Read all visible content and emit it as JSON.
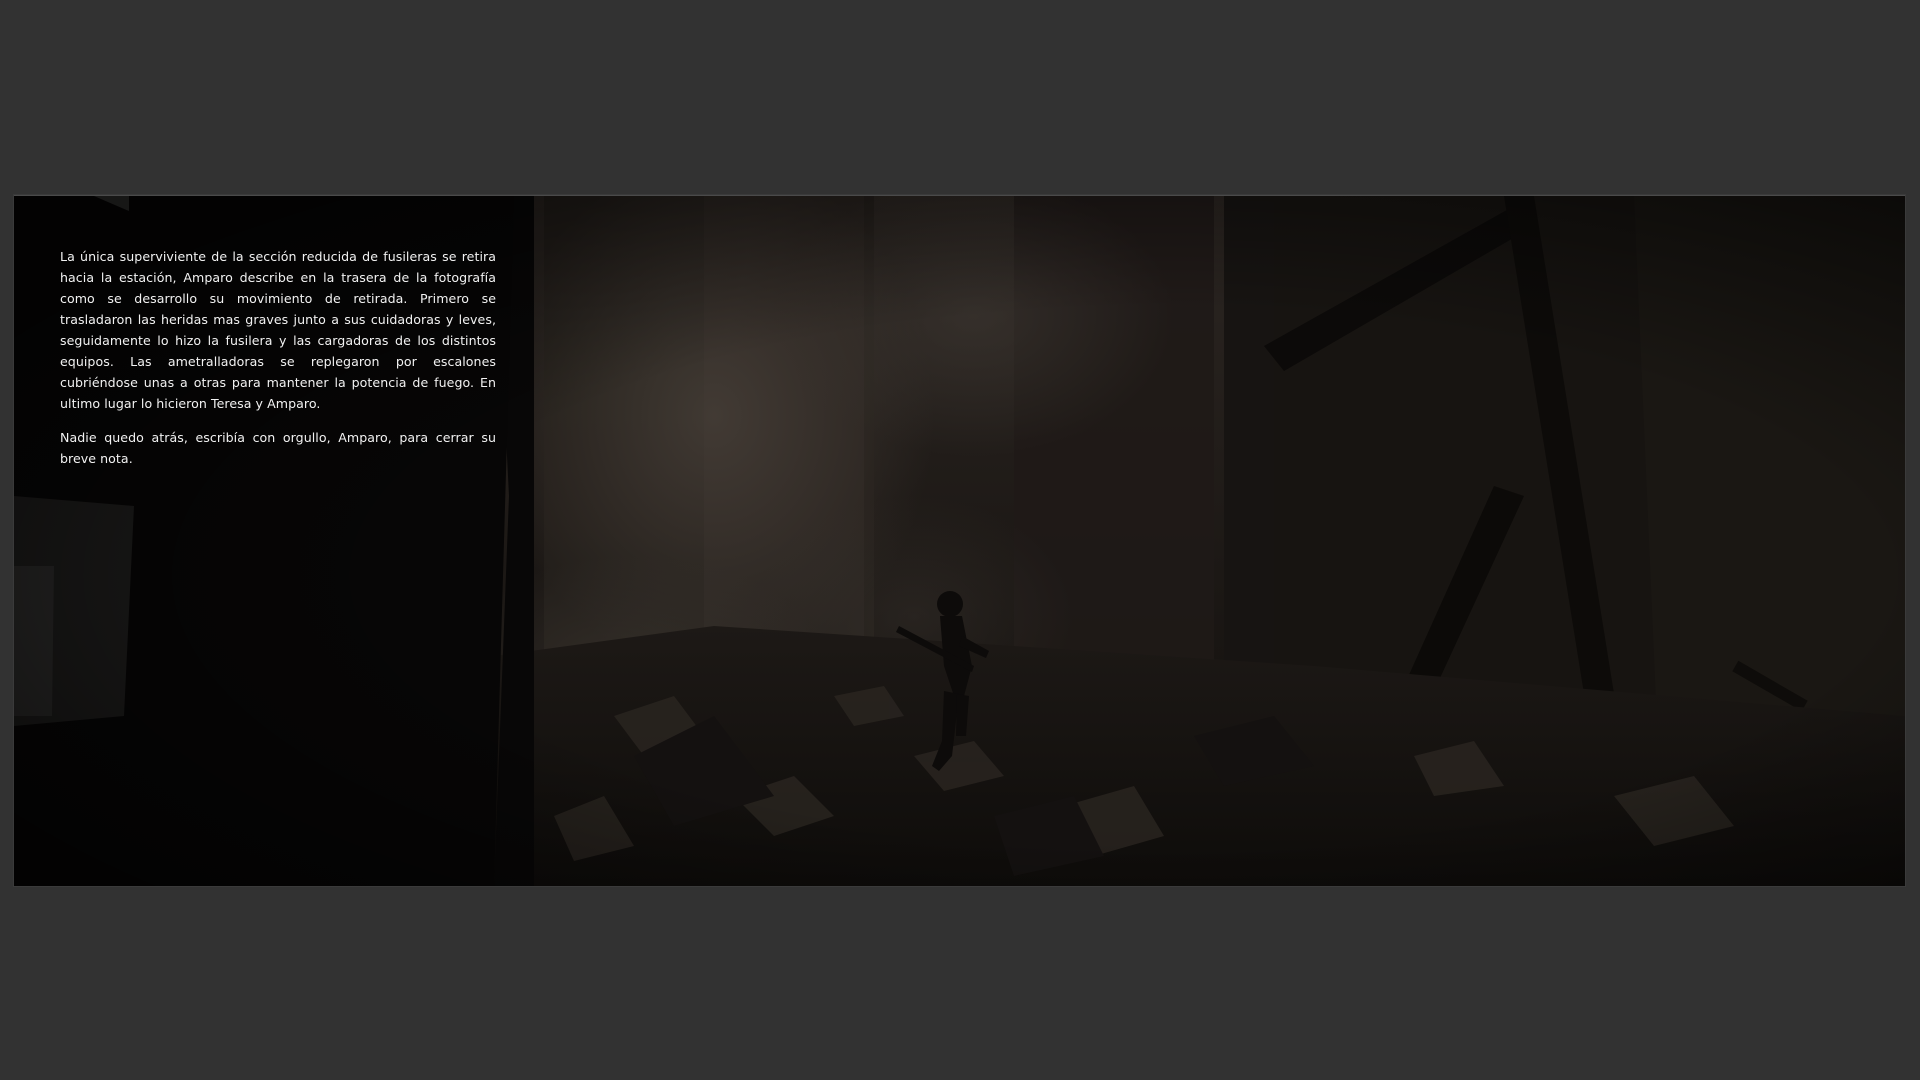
{
  "page": {
    "background_color": "#323232"
  },
  "spread": {
    "paragraphs": [
      "La única superviviente de la sección reducida de fusileras se retira hacia la estación, Amparo describe en la trasera de la fotografía como se desarrollo su movimiento de retirada. Primero se trasladaron las heridas mas graves junto a sus cuidadoras y leves, seguidamente lo hizo la fusilera y las cargadoras de los distintos equipos. Las ametralladoras se replegaron por escalones cubriéndose unas a otras para mantener la potencia de fuego. En ultimo lugar lo hicieron Teresa y Amparo.",
      "Nadie quedo atrás, escribía con orgullo, Amparo, para cerrar su breve nota."
    ]
  }
}
